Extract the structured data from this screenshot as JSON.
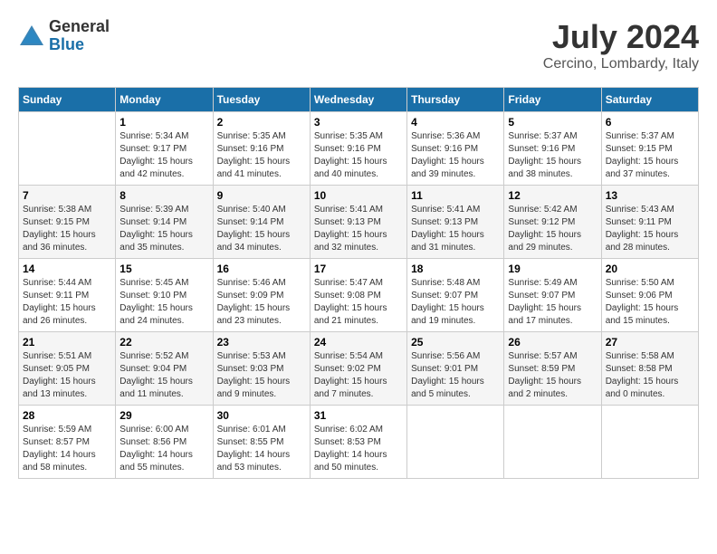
{
  "logo": {
    "general": "General",
    "blue": "Blue"
  },
  "title": {
    "month": "July 2024",
    "location": "Cercino, Lombardy, Italy"
  },
  "weekdays": [
    "Sunday",
    "Monday",
    "Tuesday",
    "Wednesday",
    "Thursday",
    "Friday",
    "Saturday"
  ],
  "weeks": [
    [
      {
        "day": "",
        "sunrise": "",
        "sunset": "",
        "daylight": ""
      },
      {
        "day": "1",
        "sunrise": "Sunrise: 5:34 AM",
        "sunset": "Sunset: 9:17 PM",
        "daylight": "Daylight: 15 hours and 42 minutes."
      },
      {
        "day": "2",
        "sunrise": "Sunrise: 5:35 AM",
        "sunset": "Sunset: 9:16 PM",
        "daylight": "Daylight: 15 hours and 41 minutes."
      },
      {
        "day": "3",
        "sunrise": "Sunrise: 5:35 AM",
        "sunset": "Sunset: 9:16 PM",
        "daylight": "Daylight: 15 hours and 40 minutes."
      },
      {
        "day": "4",
        "sunrise": "Sunrise: 5:36 AM",
        "sunset": "Sunset: 9:16 PM",
        "daylight": "Daylight: 15 hours and 39 minutes."
      },
      {
        "day": "5",
        "sunrise": "Sunrise: 5:37 AM",
        "sunset": "Sunset: 9:16 PM",
        "daylight": "Daylight: 15 hours and 38 minutes."
      },
      {
        "day": "6",
        "sunrise": "Sunrise: 5:37 AM",
        "sunset": "Sunset: 9:15 PM",
        "daylight": "Daylight: 15 hours and 37 minutes."
      }
    ],
    [
      {
        "day": "7",
        "sunrise": "Sunrise: 5:38 AM",
        "sunset": "Sunset: 9:15 PM",
        "daylight": "Daylight: 15 hours and 36 minutes."
      },
      {
        "day": "8",
        "sunrise": "Sunrise: 5:39 AM",
        "sunset": "Sunset: 9:14 PM",
        "daylight": "Daylight: 15 hours and 35 minutes."
      },
      {
        "day": "9",
        "sunrise": "Sunrise: 5:40 AM",
        "sunset": "Sunset: 9:14 PM",
        "daylight": "Daylight: 15 hours and 34 minutes."
      },
      {
        "day": "10",
        "sunrise": "Sunrise: 5:41 AM",
        "sunset": "Sunset: 9:13 PM",
        "daylight": "Daylight: 15 hours and 32 minutes."
      },
      {
        "day": "11",
        "sunrise": "Sunrise: 5:41 AM",
        "sunset": "Sunset: 9:13 PM",
        "daylight": "Daylight: 15 hours and 31 minutes."
      },
      {
        "day": "12",
        "sunrise": "Sunrise: 5:42 AM",
        "sunset": "Sunset: 9:12 PM",
        "daylight": "Daylight: 15 hours and 29 minutes."
      },
      {
        "day": "13",
        "sunrise": "Sunrise: 5:43 AM",
        "sunset": "Sunset: 9:11 PM",
        "daylight": "Daylight: 15 hours and 28 minutes."
      }
    ],
    [
      {
        "day": "14",
        "sunrise": "Sunrise: 5:44 AM",
        "sunset": "Sunset: 9:11 PM",
        "daylight": "Daylight: 15 hours and 26 minutes."
      },
      {
        "day": "15",
        "sunrise": "Sunrise: 5:45 AM",
        "sunset": "Sunset: 9:10 PM",
        "daylight": "Daylight: 15 hours and 24 minutes."
      },
      {
        "day": "16",
        "sunrise": "Sunrise: 5:46 AM",
        "sunset": "Sunset: 9:09 PM",
        "daylight": "Daylight: 15 hours and 23 minutes."
      },
      {
        "day": "17",
        "sunrise": "Sunrise: 5:47 AM",
        "sunset": "Sunset: 9:08 PM",
        "daylight": "Daylight: 15 hours and 21 minutes."
      },
      {
        "day": "18",
        "sunrise": "Sunrise: 5:48 AM",
        "sunset": "Sunset: 9:07 PM",
        "daylight": "Daylight: 15 hours and 19 minutes."
      },
      {
        "day": "19",
        "sunrise": "Sunrise: 5:49 AM",
        "sunset": "Sunset: 9:07 PM",
        "daylight": "Daylight: 15 hours and 17 minutes."
      },
      {
        "day": "20",
        "sunrise": "Sunrise: 5:50 AM",
        "sunset": "Sunset: 9:06 PM",
        "daylight": "Daylight: 15 hours and 15 minutes."
      }
    ],
    [
      {
        "day": "21",
        "sunrise": "Sunrise: 5:51 AM",
        "sunset": "Sunset: 9:05 PM",
        "daylight": "Daylight: 15 hours and 13 minutes."
      },
      {
        "day": "22",
        "sunrise": "Sunrise: 5:52 AM",
        "sunset": "Sunset: 9:04 PM",
        "daylight": "Daylight: 15 hours and 11 minutes."
      },
      {
        "day": "23",
        "sunrise": "Sunrise: 5:53 AM",
        "sunset": "Sunset: 9:03 PM",
        "daylight": "Daylight: 15 hours and 9 minutes."
      },
      {
        "day": "24",
        "sunrise": "Sunrise: 5:54 AM",
        "sunset": "Sunset: 9:02 PM",
        "daylight": "Daylight: 15 hours and 7 minutes."
      },
      {
        "day": "25",
        "sunrise": "Sunrise: 5:56 AM",
        "sunset": "Sunset: 9:01 PM",
        "daylight": "Daylight: 15 hours and 5 minutes."
      },
      {
        "day": "26",
        "sunrise": "Sunrise: 5:57 AM",
        "sunset": "Sunset: 8:59 PM",
        "daylight": "Daylight: 15 hours and 2 minutes."
      },
      {
        "day": "27",
        "sunrise": "Sunrise: 5:58 AM",
        "sunset": "Sunset: 8:58 PM",
        "daylight": "Daylight: 15 hours and 0 minutes."
      }
    ],
    [
      {
        "day": "28",
        "sunrise": "Sunrise: 5:59 AM",
        "sunset": "Sunset: 8:57 PM",
        "daylight": "Daylight: 14 hours and 58 minutes."
      },
      {
        "day": "29",
        "sunrise": "Sunrise: 6:00 AM",
        "sunset": "Sunset: 8:56 PM",
        "daylight": "Daylight: 14 hours and 55 minutes."
      },
      {
        "day": "30",
        "sunrise": "Sunrise: 6:01 AM",
        "sunset": "Sunset: 8:55 PM",
        "daylight": "Daylight: 14 hours and 53 minutes."
      },
      {
        "day": "31",
        "sunrise": "Sunrise: 6:02 AM",
        "sunset": "Sunset: 8:53 PM",
        "daylight": "Daylight: 14 hours and 50 minutes."
      },
      {
        "day": "",
        "sunrise": "",
        "sunset": "",
        "daylight": ""
      },
      {
        "day": "",
        "sunrise": "",
        "sunset": "",
        "daylight": ""
      },
      {
        "day": "",
        "sunrise": "",
        "sunset": "",
        "daylight": ""
      }
    ]
  ]
}
